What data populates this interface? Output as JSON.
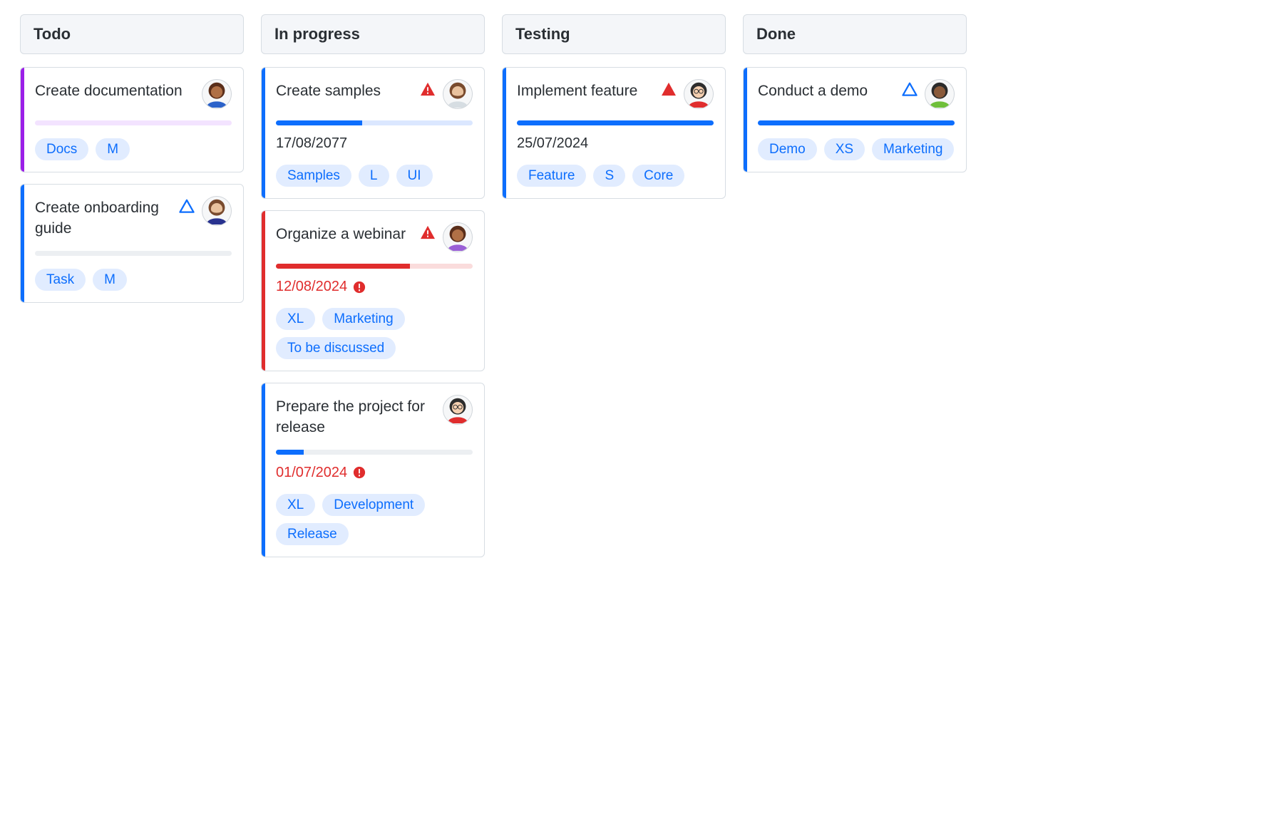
{
  "columns": [
    {
      "title": "Todo",
      "cards": [
        {
          "title": "Create documentation",
          "stripe": "purple",
          "priority": null,
          "avatar": {
            "hair": "#5a2e1a",
            "skin": "#b07046",
            "body": "#2b62c9"
          },
          "progress": {
            "value": 0,
            "track": "lilac",
            "bar": "blue"
          },
          "date": null,
          "overdue": false,
          "tags": [
            "Docs",
            "M"
          ]
        },
        {
          "title": "Create onboarding guide",
          "stripe": "blue",
          "priority": "outline-blue",
          "avatar": {
            "hair": "#794b2e",
            "skin": "#e9c29e",
            "beard": "#794b2e",
            "body": "#28328f"
          },
          "progress": {
            "value": 0,
            "track": "grey",
            "bar": "blue"
          },
          "date": null,
          "overdue": false,
          "tags": [
            "Task",
            "M"
          ]
        }
      ]
    },
    {
      "title": "In progress",
      "cards": [
        {
          "title": "Create samples",
          "stripe": "blue",
          "priority": "warn-red",
          "avatar": {
            "hair": "#794b2e",
            "skin": "#e9c29e",
            "beard": "#794b2e",
            "body": "#d6dde2"
          },
          "progress": {
            "value": 44,
            "track": "blue",
            "bar": "blue"
          },
          "date": "17/08/2077",
          "overdue": false,
          "tags": [
            "Samples",
            "L",
            "UI"
          ]
        },
        {
          "title": "Organize a webinar",
          "stripe": "red",
          "priority": "warn-red",
          "avatar": {
            "hair": "#5a2e1a",
            "skin": "#b07046",
            "body": "#9a60d6"
          },
          "progress": {
            "value": 68,
            "track": "red",
            "bar": "red"
          },
          "date": "12/08/2024",
          "overdue": true,
          "tags": [
            "XL",
            "Marketing",
            "To be discussed"
          ]
        },
        {
          "title": "Prepare the project for release",
          "stripe": "blue",
          "priority": null,
          "avatar": {
            "hair": "#2d2d2d",
            "skin": "#f4cfb0",
            "body": "#e02d2d",
            "glasses": true
          },
          "progress": {
            "value": 14,
            "track": "grey",
            "bar": "blue"
          },
          "date": "01/07/2024",
          "overdue": true,
          "tags": [
            "XL",
            "Development",
            "Release"
          ]
        }
      ]
    },
    {
      "title": "Testing",
      "cards": [
        {
          "title": "Implement feature",
          "stripe": "blue",
          "priority": "solid-red",
          "avatar": {
            "hair": "#2d2d2d",
            "skin": "#f4cfb0",
            "body": "#e02d2d",
            "glasses": true
          },
          "progress": {
            "value": 100,
            "track": "blue",
            "bar": "blue"
          },
          "date": "25/07/2024",
          "overdue": false,
          "tags": [
            "Feature",
            "S",
            "Core"
          ]
        }
      ]
    },
    {
      "title": "Done",
      "cards": [
        {
          "title": "Conduct a demo",
          "stripe": "blue",
          "priority": "outline-blue",
          "avatar": {
            "hair": "#2b2b2b",
            "skin": "#8a5a3a",
            "body": "#6fbf3a"
          },
          "progress": {
            "value": 100,
            "track": "blue",
            "bar": "blue"
          },
          "date": null,
          "overdue": false,
          "tags": [
            "Demo",
            "XS",
            "Marketing"
          ]
        }
      ]
    }
  ]
}
